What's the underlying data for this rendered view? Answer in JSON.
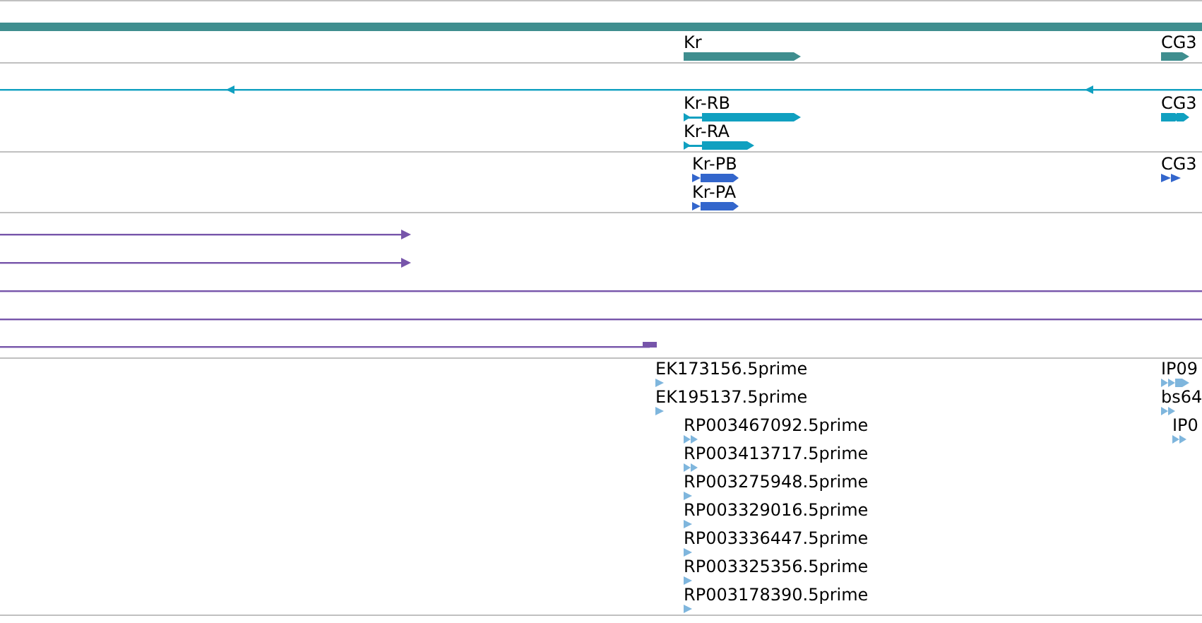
{
  "tracks": [
    {
      "kind": "gene-summary",
      "features": [
        {
          "label": "Kr"
        },
        {
          "label": "CG3"
        }
      ]
    },
    {
      "kind": "transcripts",
      "features": [
        {
          "label": "Kr-RB"
        },
        {
          "label": "Kr-RA"
        },
        {
          "label": "CG3"
        }
      ]
    },
    {
      "kind": "proteins",
      "features": [
        {
          "label": "Kr-PB"
        },
        {
          "label": "Kr-PA"
        },
        {
          "label": "CG3"
        }
      ]
    },
    {
      "kind": "alignments"
    },
    {
      "kind": "ests",
      "features": [
        {
          "label": "EK173156.5prime"
        },
        {
          "label": "EK195137.5prime"
        },
        {
          "label": "RP003467092.5prime"
        },
        {
          "label": "RP003413717.5prime"
        },
        {
          "label": "RP003275948.5prime"
        },
        {
          "label": "RP003329016.5prime"
        },
        {
          "label": "RP003336447.5prime"
        },
        {
          "label": "RP003325356.5prime"
        },
        {
          "label": "RP003178390.5prime"
        },
        {
          "label": "IP09"
        },
        {
          "label": "bs64"
        },
        {
          "label": "IP0"
        }
      ]
    }
  ]
}
